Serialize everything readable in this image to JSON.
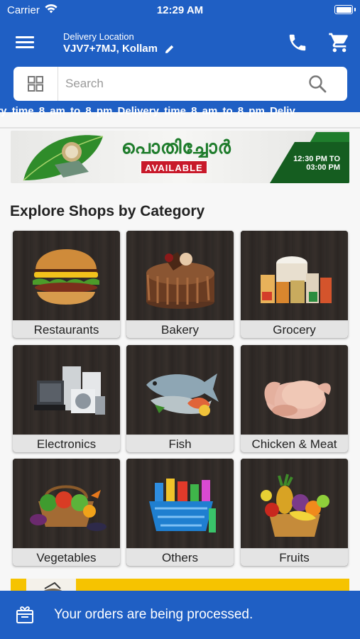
{
  "status_bar": {
    "carrier": "Carrier",
    "time": "12:29 AM"
  },
  "header": {
    "location_label": "Delivery Location",
    "location_value": "VJV7+7MJ, Kollam"
  },
  "search": {
    "placeholder": "Search"
  },
  "ticker": {
    "text": "ery time 8 am to 8 pm    Delivery time 8 am to 8 pm    Deliv"
  },
  "banner": {
    "title": "പൊതിച്ചോർ",
    "badge": "AVAILABLE",
    "time_line1": "12:30 PM TO",
    "time_line2": "03:00 PM"
  },
  "section_title": "Explore Shops by Category",
  "categories": [
    {
      "label": "Restaurants",
      "icon": "burger-icon"
    },
    {
      "label": "Bakery",
      "icon": "cake-icon"
    },
    {
      "label": "Grocery",
      "icon": "grocery-icon"
    },
    {
      "label": "Electronics",
      "icon": "appliances-icon"
    },
    {
      "label": "Fish",
      "icon": "fish-icon"
    },
    {
      "label": "Chicken & Meat",
      "icon": "chicken-icon"
    },
    {
      "label": "Vegetables",
      "icon": "vegetables-icon"
    },
    {
      "label": "Others",
      "icon": "basket-icon"
    },
    {
      "label": "Fruits",
      "icon": "fruits-icon"
    }
  ],
  "toast": {
    "message": "Your orders are being processed."
  },
  "colors": {
    "primary": "#1f5fc4",
    "banner_green": "#1e7c2b",
    "badge_red": "#c8192a",
    "promo_yellow": "#f6c300"
  }
}
